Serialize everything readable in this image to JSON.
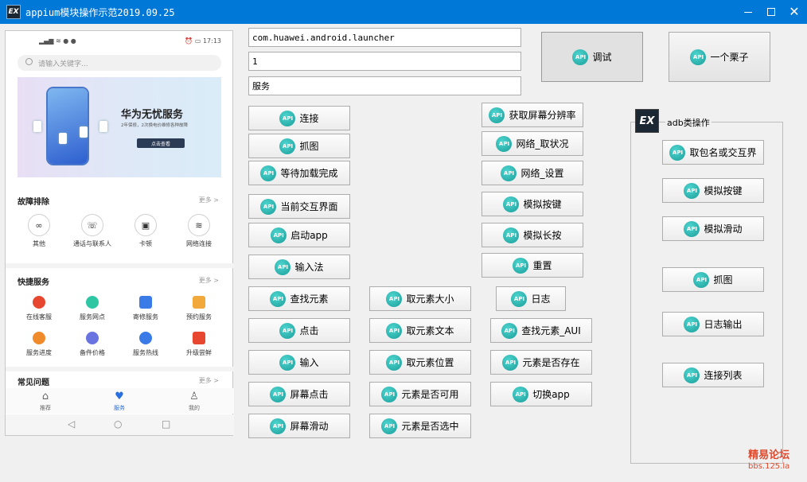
{
  "window": {
    "title": "appium模块操作示范2019.09.25",
    "icon_text": "EX",
    "minimize_icon": "minimize-icon",
    "maximize_icon": "maximize-icon",
    "close_symbol": "✕"
  },
  "phone": {
    "status_time": "17:13",
    "search_placeholder": "请输入关键字...",
    "banner": {
      "title": "华为无忧服务",
      "subtitle": "2年保修，2次换电价维修各种故障",
      "button": "点击查看"
    },
    "sections": [
      {
        "title": "故障排除",
        "more": "更多 >",
        "items": [
          {
            "label": "其他",
            "icon": "∞"
          },
          {
            "label": "通话与联系人",
            "icon": "☏"
          },
          {
            "label": "卡顿",
            "icon": "▣"
          },
          {
            "label": "网络连接",
            "icon": "≋"
          }
        ]
      },
      {
        "title": "快捷服务",
        "more": "更多 >",
        "items": [
          {
            "label": "在线客服",
            "color": "#e8472f"
          },
          {
            "label": "服务网点",
            "color": "#2fc6a4"
          },
          {
            "label": "寄修服务",
            "color": "#3a7be8"
          },
          {
            "label": "预约服务",
            "color": "#f2a93b"
          },
          {
            "label": "服务进度",
            "color": "#f08b2c"
          },
          {
            "label": "备件价格",
            "color": "#6a74e0"
          },
          {
            "label": "服务热线",
            "color": "#3a7be8"
          },
          {
            "label": "升级尝鲜",
            "color": "#e8472f"
          }
        ]
      },
      {
        "title": "常见问题",
        "more": "更多 >",
        "items": []
      }
    ],
    "tabs": [
      "推荐",
      "服务",
      "我的"
    ],
    "active_tab_color": "#2a6fe0"
  },
  "fields": {
    "package": "com.huawei.android.launcher",
    "index": "1",
    "text": "服务"
  },
  "api_badge": "API",
  "buttons": {
    "debug": "调试",
    "example": "一个栗子",
    "col1": [
      "连接",
      "抓图",
      "等待加载完成",
      "当前交互界面",
      "启动app",
      "输入法",
      "查找元素",
      "点击",
      "输入",
      "屏幕点击",
      "屏幕滑动"
    ],
    "col2": [
      "取元素大小",
      "取元素文本",
      "取元素位置",
      "元素是否可用",
      "元素是否选中"
    ],
    "col3": [
      "获取屏幕分辨率",
      "网络_取状况",
      "网络_设置",
      "模拟按键",
      "模拟长按",
      "重置",
      "日志",
      "查找元素_AUI",
      "元素是否存在",
      "切换app"
    ]
  },
  "adb_group": {
    "title": "adb类操作",
    "icon_text": "EX",
    "buttons": [
      "取包名或交互界",
      "模拟按键",
      "模拟滑动",
      "抓图",
      "日志输出",
      "连接列表"
    ]
  },
  "watermark": {
    "line1": "精易论坛",
    "line2": "bbs.125.la"
  },
  "colors": {
    "titlebar": "#0078d7",
    "api_icon": "#22b3ad"
  }
}
